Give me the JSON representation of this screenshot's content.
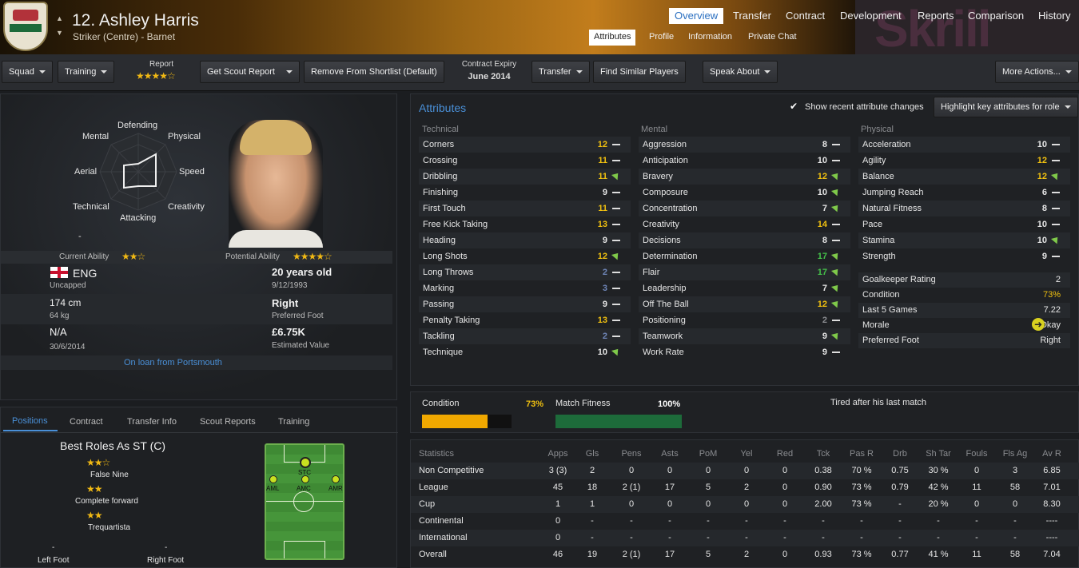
{
  "header": {
    "player_name": "12. Ashley Harris",
    "player_sub": "Striker (Centre) - Barnet",
    "sponsor": "Skrill",
    "nav_tabs": [
      "Overview",
      "Transfer",
      "Contract",
      "Development",
      "Reports",
      "Comparison",
      "History"
    ],
    "sub_tabs": [
      "Attributes",
      "Profile",
      "Information",
      "Private Chat"
    ]
  },
  "toolbar": {
    "squad": "Squad",
    "training": "Training",
    "report_label": "Report",
    "get_scout_report": "Get Scout Report",
    "remove_shortlist": "Remove From Shortlist (Default)",
    "contract_expiry_label": "Contract Expiry",
    "contract_expiry": "June 2014",
    "transfer": "Transfer",
    "find_similar": "Find Similar Players",
    "speak_about": "Speak About",
    "more_actions": "More Actions..."
  },
  "profile": {
    "radar": [
      "Defending",
      "Physical",
      "Speed",
      "Creativity",
      "Attacking",
      "Technical",
      "Aerial",
      "Mental"
    ],
    "radar_dash": "-",
    "current_ability_label": "Current Ability",
    "potential_ability_label": "Potential Ability",
    "nation": "ENG",
    "caps": "Uncapped",
    "age": "20 years old",
    "dob": "9/12/1993",
    "height": "174 cm",
    "weight": "64 kg",
    "foot": "Right",
    "foot_label": "Preferred Foot",
    "wage": "N/A",
    "contract_date": "30/6/2014",
    "value": "£6.75K",
    "value_label": "Estimated Value",
    "loan": "On loan from Portsmouth"
  },
  "bottom_tabs": [
    "Positions",
    "Contract",
    "Transfer Info",
    "Scout Reports",
    "Training"
  ],
  "roles": {
    "title": "Best Roles As ST (C)",
    "list": [
      "False Nine",
      "Complete forward",
      "Trequartista"
    ],
    "left_foot_label": "Left Foot",
    "right_foot_label": "Right Foot",
    "foot_dash": "-",
    "positions": [
      "STC",
      "AML",
      "AMC",
      "AMR"
    ]
  },
  "attributes": {
    "title": "Attributes",
    "show_recent": "Show recent attribute changes",
    "highlight": "Highlight key attributes for role",
    "technical_label": "Technical",
    "mental_label": "Mental",
    "physical_label": "Physical",
    "technical": [
      {
        "name": "Corners",
        "value": "12"
      },
      {
        "name": "Crossing",
        "value": "11"
      },
      {
        "name": "Dribbling",
        "value": "11"
      },
      {
        "name": "Finishing",
        "value": "9"
      },
      {
        "name": "First Touch",
        "value": "11"
      },
      {
        "name": "Free Kick Taking",
        "value": "13"
      },
      {
        "name": "Heading",
        "value": "9"
      },
      {
        "name": "Long Shots",
        "value": "12"
      },
      {
        "name": "Long Throws",
        "value": "2"
      },
      {
        "name": "Marking",
        "value": "3"
      },
      {
        "name": "Passing",
        "value": "9"
      },
      {
        "name": "Penalty Taking",
        "value": "13"
      },
      {
        "name": "Tackling",
        "value": "2"
      },
      {
        "name": "Technique",
        "value": "10"
      }
    ],
    "mental": [
      {
        "name": "Aggression",
        "value": "8"
      },
      {
        "name": "Anticipation",
        "value": "10"
      },
      {
        "name": "Bravery",
        "value": "12"
      },
      {
        "name": "Composure",
        "value": "10"
      },
      {
        "name": "Concentration",
        "value": "7"
      },
      {
        "name": "Creativity",
        "value": "14"
      },
      {
        "name": "Decisions",
        "value": "8"
      },
      {
        "name": "Determination",
        "value": "17"
      },
      {
        "name": "Flair",
        "value": "17"
      },
      {
        "name": "Leadership",
        "value": "7"
      },
      {
        "name": "Off The Ball",
        "value": "12"
      },
      {
        "name": "Positioning",
        "value": "2"
      },
      {
        "name": "Teamwork",
        "value": "9"
      },
      {
        "name": "Work Rate",
        "value": "9"
      }
    ],
    "physical": [
      {
        "name": "Acceleration",
        "value": "10"
      },
      {
        "name": "Agility",
        "value": "12"
      },
      {
        "name": "Balance",
        "value": "12"
      },
      {
        "name": "Jumping Reach",
        "value": "6"
      },
      {
        "name": "Natural Fitness",
        "value": "8"
      },
      {
        "name": "Pace",
        "value": "10"
      },
      {
        "name": "Stamina",
        "value": "10"
      },
      {
        "name": "Strength",
        "value": "9"
      }
    ],
    "extra": [
      {
        "name": "Goalkeeper Rating",
        "value": "2"
      },
      {
        "name": "Condition",
        "value": "73%"
      },
      {
        "name": "Last 5 Games",
        "value": "7.22"
      },
      {
        "name": "Morale",
        "value": "Okay"
      },
      {
        "name": "Preferred Foot",
        "value": "Right"
      }
    ]
  },
  "condition": {
    "condition_label": "Condition",
    "condition_value": "73%",
    "condition_fill": 0.73,
    "fitness_label": "Match Fitness",
    "fitness_value": "100%",
    "fitness_fill": 1.0,
    "note": "Tired after his last match"
  },
  "statistics": {
    "headers": [
      "Statistics",
      "Apps",
      "Gls",
      "Pens",
      "Asts",
      "PoM",
      "Yel",
      "Red",
      "Tck",
      "Pas R",
      "Drb",
      "Sh Tar",
      "Fouls",
      "Fls Ag",
      "Av R"
    ],
    "rows": [
      [
        "Non Competitive",
        "3 (3)",
        "2",
        "0",
        "0",
        "0",
        "0",
        "0",
        "0.38",
        "70 %",
        "0.75",
        "30 %",
        "0",
        "3",
        "6.85"
      ],
      [
        "League",
        "45",
        "18",
        "2 (1)",
        "17",
        "5",
        "2",
        "0",
        "0.90",
        "73 %",
        "0.79",
        "42 %",
        "11",
        "58",
        "7.01"
      ],
      [
        "Cup",
        "1",
        "1",
        "0",
        "0",
        "0",
        "0",
        "0",
        "2.00",
        "73 %",
        "-",
        "20 %",
        "0",
        "0",
        "8.30"
      ],
      [
        "Continental",
        "0",
        "-",
        "-",
        "-",
        "-",
        "-",
        "-",
        "-",
        "-",
        "-",
        "-",
        "-",
        "-",
        "----"
      ],
      [
        "International",
        "0",
        "-",
        "-",
        "-",
        "-",
        "-",
        "-",
        "-",
        "-",
        "-",
        "-",
        "-",
        "-",
        "----"
      ],
      [
        "Overall",
        "46",
        "19",
        "2 (1)",
        "17",
        "5",
        "2",
        "0",
        "0.93",
        "73 %",
        "0.77",
        "41 %",
        "11",
        "58",
        "7.04"
      ]
    ]
  }
}
